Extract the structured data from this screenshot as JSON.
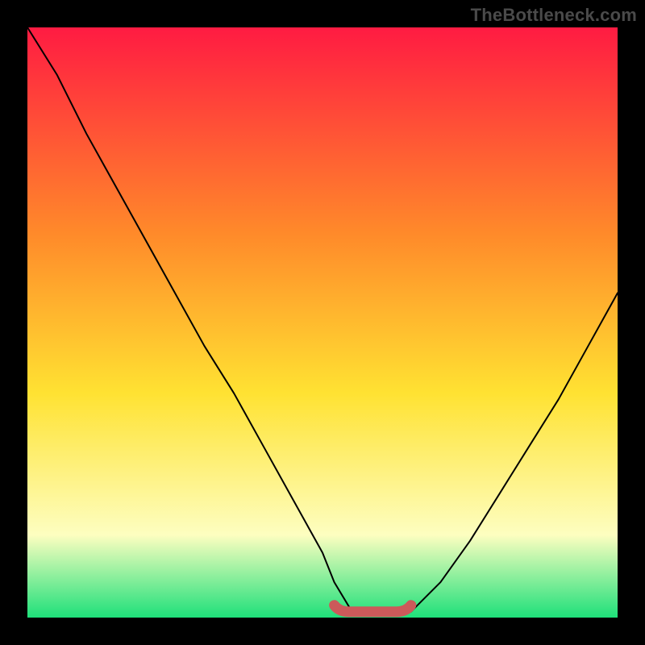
{
  "watermark": "TheBottleneck.com",
  "colors": {
    "frame": "#000000",
    "gradient_top": "#ff1b42",
    "gradient_mid1": "#ff8a2a",
    "gradient_mid2": "#ffe232",
    "gradient_lower": "#fdfec0",
    "gradient_bottom": "#1ee07a",
    "curve": "#000000",
    "marker": "#cc5a5a"
  },
  "chart_data": {
    "type": "line",
    "title": "",
    "xlabel": "",
    "ylabel": "",
    "xlim": [
      0,
      100
    ],
    "ylim": [
      0,
      100
    ],
    "series": [
      {
        "name": "bottleneck-curve",
        "x": [
          0,
          5,
          10,
          15,
          20,
          25,
          30,
          35,
          40,
          45,
          50,
          52,
          55,
          58,
          60,
          62,
          65,
          70,
          75,
          80,
          85,
          90,
          95,
          100
        ],
        "y": [
          100,
          92,
          82,
          73,
          64,
          55,
          46,
          38,
          29,
          20,
          11,
          6,
          1,
          0.5,
          0.5,
          0.5,
          1,
          6,
          13,
          21,
          29,
          37,
          46,
          55
        ]
      }
    ],
    "highlight_range": {
      "x_start": 52,
      "x_end": 65,
      "y": 1,
      "style": "rounded-red-band"
    },
    "annotations": []
  }
}
